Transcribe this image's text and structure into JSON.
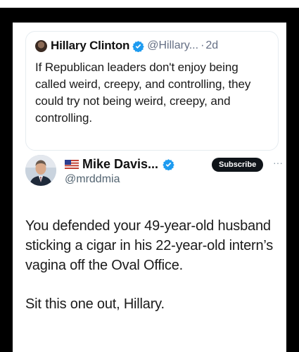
{
  "quoted_tweet": {
    "author_name": "Hillary Clinton",
    "author_handle": "@Hillary...",
    "separator": "·",
    "age": "2d",
    "text": "If Republican leaders don't enjoy being called weird, creepy, and controlling, they could try not being weird, creepy, and controlling."
  },
  "tweet": {
    "author_name": "Mike Davis...",
    "author_handle": "@mrddmia",
    "subscribe_label": "Subscribe",
    "more_label": "···",
    "paragraphs": [
      "You defended your 49-year-old husband sticking a cigar in his 22-year-old intern’s vagina off the Oval Office.",
      "Sit this one out, Hillary."
    ]
  },
  "colors": {
    "verified_blue": "#1d9bf0",
    "background": "#000000",
    "card": "#ffffff"
  },
  "icons": [
    "verified-badge-icon",
    "us-flag-icon",
    "more-options-icon"
  ]
}
